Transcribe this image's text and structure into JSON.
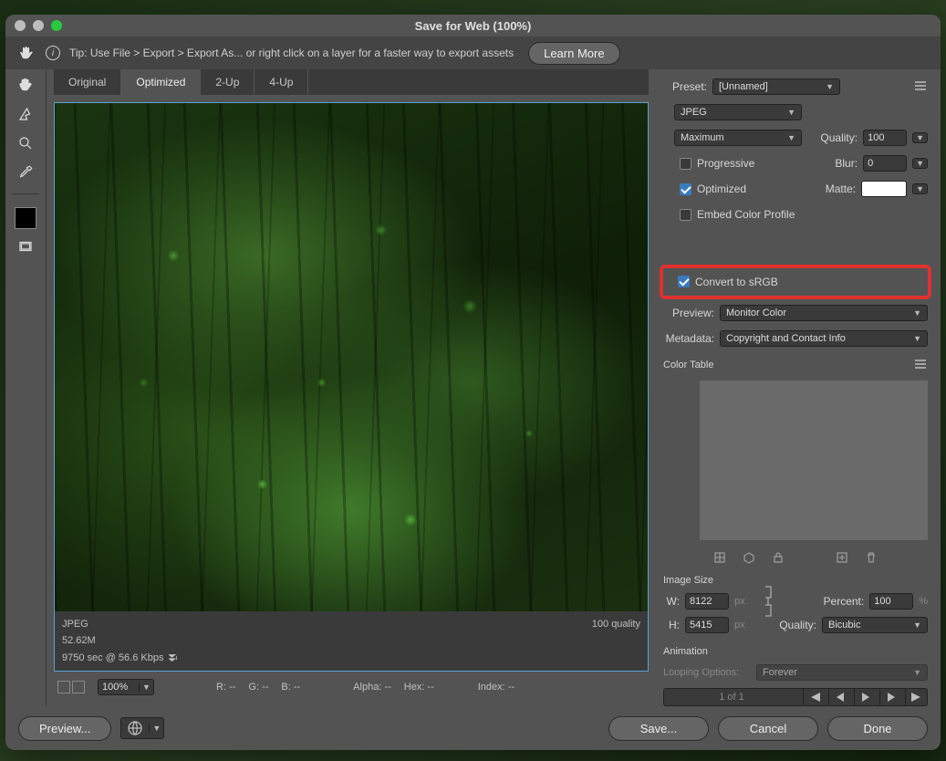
{
  "window": {
    "title": "Save for Web (100%)"
  },
  "tip": {
    "text": "Tip: Use File > Export > Export As...  or right click on a layer for a faster way to export assets",
    "learn": "Learn More"
  },
  "tabs": {
    "original": "Original",
    "optimized": "Optimized",
    "twoup": "2-Up",
    "fourup": "4-Up"
  },
  "previewMeta": {
    "format": "JPEG",
    "quality": "100 quality",
    "size": "52.62M",
    "timing": "9750 sec @ 56.6 Kbps"
  },
  "status": {
    "zoom": "100%",
    "r": "R:  --",
    "g": "G:  --",
    "b": "B:  --",
    "alpha": "Alpha: --",
    "hex": "Hex: --",
    "index": "Index: --"
  },
  "panel": {
    "presetLbl": "Preset:",
    "preset": "[Unnamed]",
    "format": "JPEG",
    "compression": "Maximum",
    "qualityLbl": "Quality:",
    "quality": "100",
    "progressive": "Progressive",
    "blurLbl": "Blur:",
    "blur": "0",
    "optimized": "Optimized",
    "matteLbl": "Matte:",
    "embed": "Embed Color Profile",
    "convert": "Convert to sRGB",
    "previewLbl": "Preview:",
    "preview": "Monitor Color",
    "metadataLbl": "Metadata:",
    "metadata": "Copyright and Contact Info",
    "colorTable": "Color Table",
    "imageSize": "Image Size",
    "wLbl": "W:",
    "w": "8122",
    "hLbl": "H:",
    "h": "5415",
    "px": "px",
    "percentLbl": "Percent:",
    "percent": "100",
    "pctSym": "%",
    "quality2Lbl": "Quality:",
    "quality2": "Bicubic",
    "animation": "Animation",
    "loopingLbl": "Looping Options:",
    "looping": "Forever",
    "frames": "1 of 1"
  },
  "footer": {
    "preview": "Preview...",
    "save": "Save...",
    "cancel": "Cancel",
    "done": "Done"
  }
}
